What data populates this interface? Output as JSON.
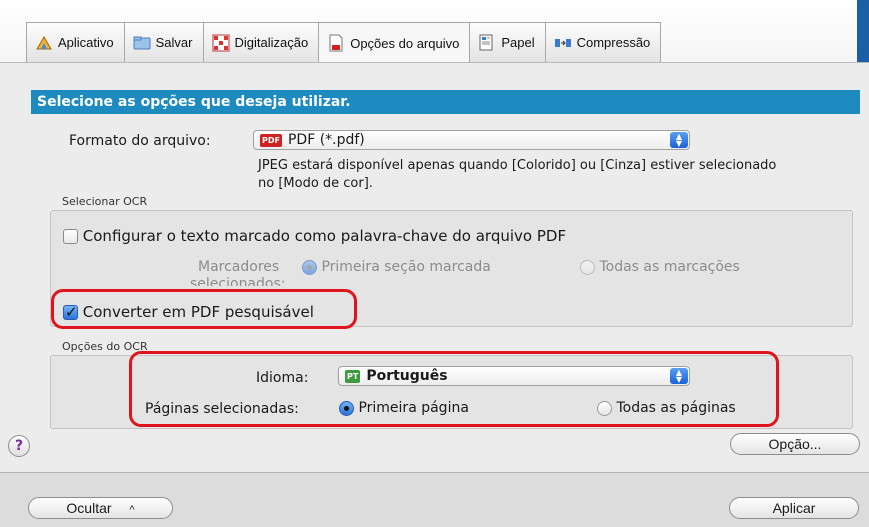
{
  "tabs": [
    {
      "label": "Aplicativo",
      "icon": "application-icon"
    },
    {
      "label": "Salvar",
      "icon": "folder-icon"
    },
    {
      "label": "Digitalização",
      "icon": "scan-icon"
    },
    {
      "label": "Opções do arquivo",
      "icon": "file-options-icon"
    },
    {
      "label": "Papel",
      "icon": "paper-icon"
    },
    {
      "label": "Compressão",
      "icon": "compression-icon"
    }
  ],
  "header": "Selecione as opções que deseja utilizar.",
  "file_format": {
    "label": "Formato do arquivo:",
    "value": "PDF (*.pdf)",
    "badge": "PDF",
    "note_line1": "JPEG estará disponível apenas quando [Colorido] ou [Cinza] estiver selecionado",
    "note_line2": "no [Modo de cor]."
  },
  "ocr_select": {
    "group_label": "Selecionar OCR",
    "keyword_checkbox": "Configurar o texto marcado como palavra-chave do arquivo PDF",
    "markers_label": "Marcadores",
    "markers_label_2": "selecionados:",
    "first_marked": "Primeira seção marcada",
    "all_marks": "Todas as marcações",
    "searchable_checkbox": "Converter em PDF pesquisável"
  },
  "ocr_options": {
    "group_label": "Opções do OCR",
    "language_label": "Idioma:",
    "language_value": "Português",
    "language_badge": "PT",
    "pages_label": "Páginas selecionadas:",
    "first_page": "Primeira página",
    "all_pages": "Todas as páginas"
  },
  "buttons": {
    "help": "?",
    "option": "Opção...",
    "hide": "Ocultar",
    "apply": "Aplicar"
  },
  "colors": {
    "header_blue": "#1d8ac0",
    "highlight_red": "#e0141c",
    "accent_blue": "#2a73dd"
  }
}
